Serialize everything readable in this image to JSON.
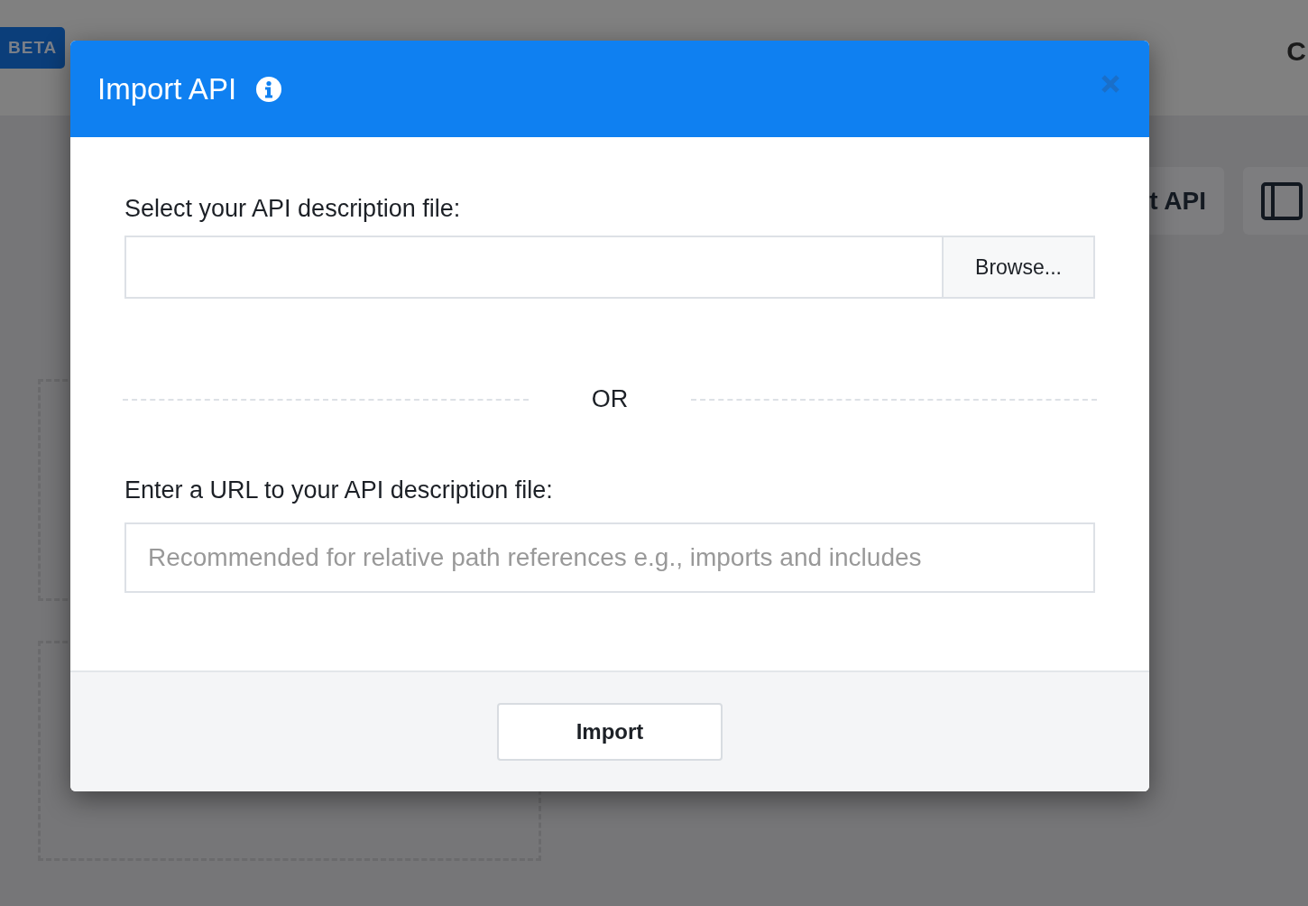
{
  "header": {
    "badge": "BETA",
    "title_fragment": "C"
  },
  "toolbar": {
    "button_fragment": "t API"
  },
  "dialog": {
    "title": "Import API",
    "file": {
      "label": "Select your API description file:",
      "button": "Browse..."
    },
    "separator": "OR",
    "url": {
      "label": "Enter a URL to your API description file:",
      "placeholder": "Recommended for relative path references e.g., imports and includes"
    },
    "submit": "Import"
  }
}
